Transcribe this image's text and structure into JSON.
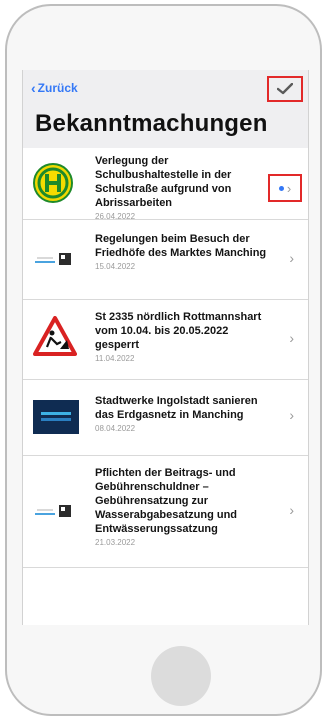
{
  "nav": {
    "back_label": "Zurück",
    "title": "Bekanntmachungen"
  },
  "announcements": [
    {
      "title": "Verlegung der Schulbushaltestelle in der Schulstraße aufgrund von Abrissarbeiten",
      "date": "26.04.2022",
      "icon": "bus-stop-icon",
      "unread": true
    },
    {
      "title": "Regelungen beim Besuch der Friedhöfe des Marktes Manching",
      "date": "15.04.2022",
      "icon": "market-logo-icon",
      "unread": false
    },
    {
      "title": "St 2335 nördlich Rottmannshart vom 10.04. bis 20.05.2022 gesperrt",
      "date": "11.04.2022",
      "icon": "roadworks-warning-icon",
      "unread": false
    },
    {
      "title": "Stadtwerke Ingolstadt sanieren das Erdgasnetz in Manching",
      "date": "08.04.2022",
      "icon": "stadtwerke-logo-icon",
      "unread": false
    },
    {
      "title": "Pflichten der Beitrags- und Gebührenschuldner – Gebührensatzung zur Wasserabgabesatzung und Entwässerungssatzung",
      "date": "21.03.2022",
      "icon": "market-logo-icon",
      "unread": false
    }
  ],
  "colors": {
    "accent": "#3478f6",
    "highlight": "#e22929"
  }
}
